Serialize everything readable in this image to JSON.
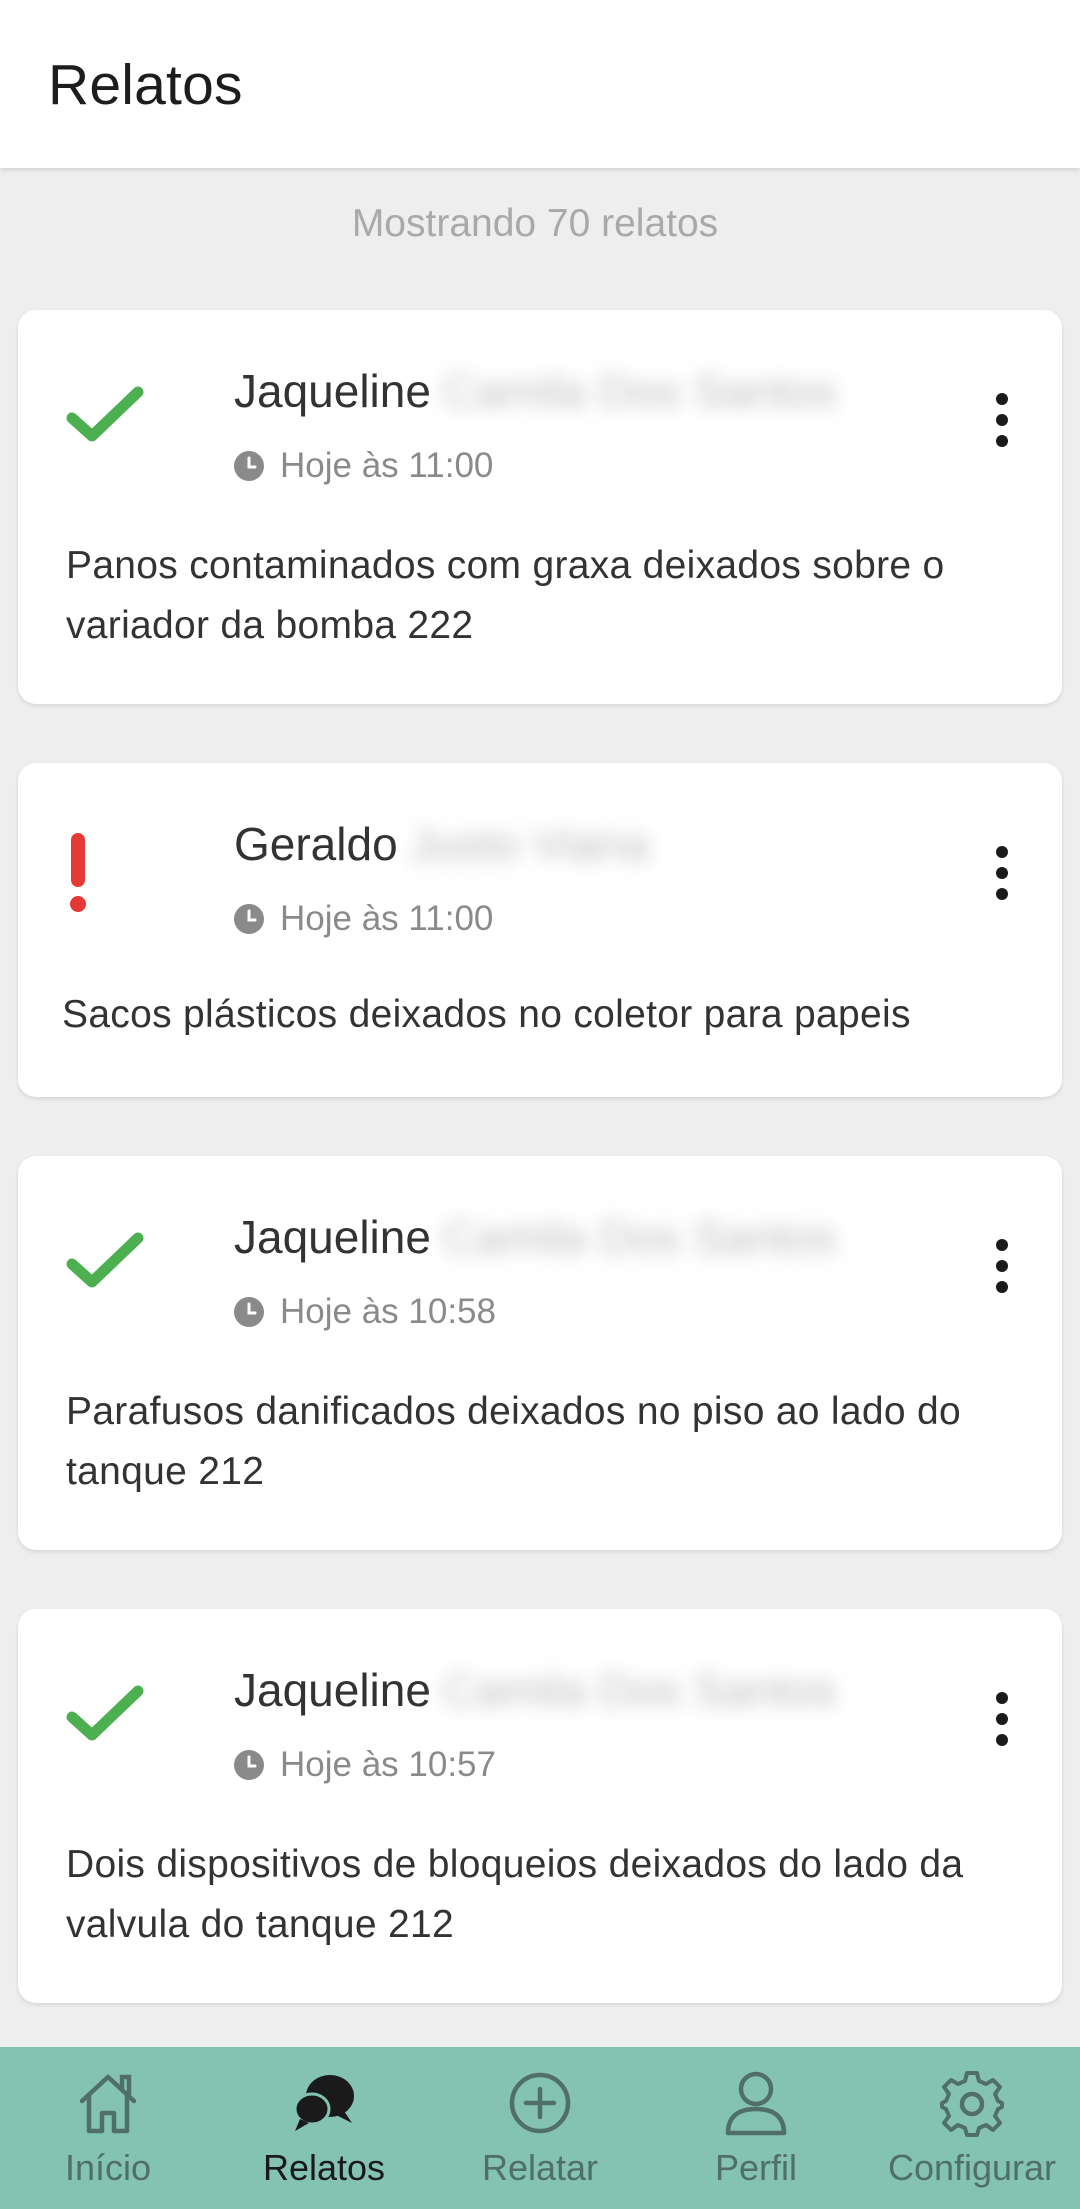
{
  "header": {
    "title": "Relatos"
  },
  "count_text": "Mostrando 70 relatos",
  "colors": {
    "success": "#4caf50",
    "alert": "#e53935",
    "nav_background": "#84c3b2"
  },
  "reports": [
    {
      "status": "check-icon",
      "author_first": "Jaqueline",
      "author_last": "Camila Dos Santos",
      "time": "Hoje às 11:00",
      "description": "Panos contaminados com graxa deixados sobre o variador da bomba 222"
    },
    {
      "status": "exclamation-icon",
      "author_first": "Geraldo",
      "author_last": "Justo Viana",
      "time": "Hoje às 11:00",
      "description": "Sacos plásticos deixados no coletor para papeis"
    },
    {
      "status": "check-icon",
      "author_first": "Jaqueline",
      "author_last": "Camila Dos Santos",
      "time": "Hoje às 10:58",
      "description": "Parafusos danificados deixados no piso ao lado do tanque 212"
    },
    {
      "status": "check-icon",
      "author_first": "Jaqueline",
      "author_last": "Camila Dos Santos",
      "time": "Hoje às 10:57",
      "description": "Dois dispositivos de bloqueios deixados do lado da valvula do tanque 212"
    }
  ],
  "nav": [
    {
      "label": "Início",
      "icon": "home-icon",
      "active": false
    },
    {
      "label": "Relatos",
      "icon": "chat-bubbles-icon",
      "active": true
    },
    {
      "label": "Relatar",
      "icon": "add-circle-icon",
      "active": false
    },
    {
      "label": "Perfil",
      "icon": "person-icon",
      "active": false
    },
    {
      "label": "Configurar",
      "icon": "gear-icon",
      "active": false
    }
  ]
}
